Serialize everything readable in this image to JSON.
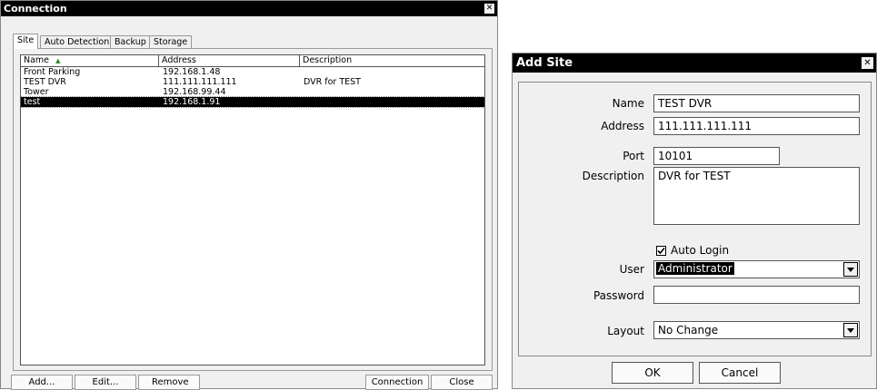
{
  "connection": {
    "title": "Connection",
    "close_glyph": "✕",
    "tabs": [
      "Site",
      "Auto Detection",
      "Backup",
      "Storage"
    ],
    "columns": {
      "name": "Name",
      "sort_glyph": "▲",
      "address": "Address",
      "description": "Description"
    },
    "rows": [
      {
        "name": "Front Parking",
        "address": "192.168.1.48",
        "description": ""
      },
      {
        "name": "TEST DVR",
        "address": "111.111.111.111",
        "description": "DVR for TEST"
      },
      {
        "name": "Tower",
        "address": "192.168.99.44",
        "description": ""
      },
      {
        "name": "test",
        "address": "192.168.1.91",
        "description": ""
      }
    ],
    "selected_row": 3,
    "buttons": {
      "add": "Add...",
      "edit": "Edit...",
      "remove": "Remove",
      "connection": "Connection",
      "close": "Close"
    }
  },
  "add_site": {
    "title": "Add Site",
    "close_glyph": "✕",
    "labels": {
      "name": "Name",
      "address": "Address",
      "port": "Port",
      "description": "Description",
      "user": "User",
      "password": "Password",
      "layout": "Layout"
    },
    "values": {
      "name": "TEST DVR",
      "address": "111.111.111.111",
      "port": "10101",
      "description": "DVR for TEST",
      "user": "Administrator",
      "password": "",
      "layout": "No Change"
    },
    "auto_login": {
      "label": "Auto Login",
      "checked": true
    },
    "buttons": {
      "ok": "OK",
      "cancel": "Cancel"
    }
  },
  "icons": {
    "sort": "sort-ascending-icon",
    "checkbox": "checkbox-checked-icon",
    "dropdown": "chevron-down-icon",
    "close": "close-icon"
  }
}
